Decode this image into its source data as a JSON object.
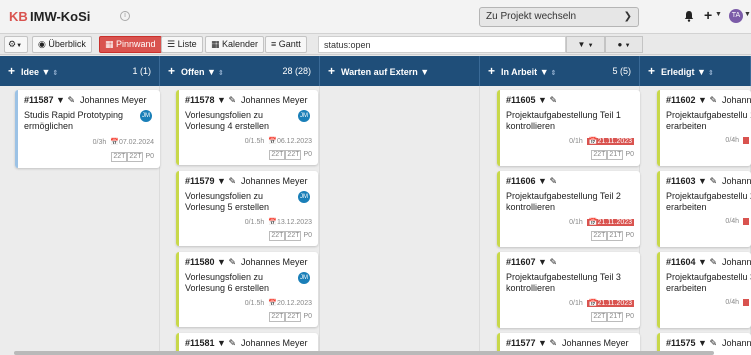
{
  "app": {
    "logo_kb": "KB",
    "name": "IMW-KoSi",
    "project_select": "Zu Projekt wechseln",
    "user_initials": "TA"
  },
  "toolbar": {
    "overview": "Überblick",
    "board": "Pinnwand",
    "list": "Liste",
    "calendar": "Kalender",
    "gantt": "Gantt",
    "search_value": "status:open"
  },
  "columns": [
    {
      "title": "Idee",
      "count": "1 (1)"
    },
    {
      "title": "Offen",
      "count": "28 (28)"
    },
    {
      "title": "Warten auf Extern",
      "count": ""
    },
    {
      "title": "In Arbeit",
      "count": "5 (5)"
    },
    {
      "title": "Erledigt",
      "count": ""
    }
  ],
  "cards": [
    {
      "id": "#11587",
      "assignee": "Johannes Meyer",
      "title": "Studis Rapid Prototyping ermöglichen",
      "time": "0/3h",
      "due": "07.02.2024",
      "overdue": false,
      "tags": [
        "22T",
        "22T"
      ],
      "priority": "P0",
      "avatar": "JM",
      "accent": "#9cc2e5"
    },
    {
      "id": "#11578",
      "assignee": "Johannes Meyer",
      "title": "Vorlesungsfolien zu Vorlesung 4 erstellen",
      "time": "0/1.5h",
      "due": "06.12.2023",
      "overdue": false,
      "tags": [
        "22T",
        "22T"
      ],
      "priority": "P0",
      "avatar": "JM",
      "accent": "#c8d84a"
    },
    {
      "id": "#11579",
      "assignee": "Johannes Meyer",
      "title": "Vorlesungsfolien zu Vorlesung 5 erstellen",
      "time": "0/1.5h",
      "due": "13.12.2023",
      "overdue": false,
      "tags": [
        "22T",
        "22T"
      ],
      "priority": "P0",
      "avatar": "JM",
      "accent": "#c8d84a"
    },
    {
      "id": "#11580",
      "assignee": "Johannes Meyer",
      "title": "Vorlesungsfolien zu Vorlesung 6 erstellen",
      "time": "0/1.5h",
      "due": "20.12.2023",
      "overdue": false,
      "tags": [
        "22T",
        "22T"
      ],
      "priority": "P0",
      "avatar": "JM",
      "accent": "#c8d84a"
    },
    {
      "id": "#11581",
      "assignee": "Johannes Meyer",
      "title": "",
      "time": "",
      "due": "",
      "overdue": false,
      "tags": [],
      "priority": "",
      "avatar": "",
      "accent": "#c8d84a"
    },
    {
      "id": "#11605",
      "assignee": "",
      "title": "Projektaufgabestellung Teil 1 kontrollieren",
      "time": "0/1h",
      "due": "21.11.2023",
      "overdue": true,
      "tags": [
        "22T",
        "21T"
      ],
      "priority": "P0",
      "avatar": "",
      "accent": "#c8d84a"
    },
    {
      "id": "#11606",
      "assignee": "",
      "title": "Projektaufgabestellung Teil 2 kontrollieren",
      "time": "0/1h",
      "due": "21.11.2023",
      "overdue": true,
      "tags": [
        "22T",
        "21T"
      ],
      "priority": "P0",
      "avatar": "",
      "accent": "#c8d84a"
    },
    {
      "id": "#11607",
      "assignee": "",
      "title": "Projektaufgabestellung Teil 3 kontrollieren",
      "time": "0/1h",
      "due": "21.11.2023",
      "overdue": true,
      "tags": [
        "22T",
        "21T"
      ],
      "priority": "P0",
      "avatar": "",
      "accent": "#c8d84a"
    },
    {
      "id": "#11577",
      "assignee": "Johannes Meyer",
      "title": "",
      "time": "",
      "due": "",
      "overdue": false,
      "tags": [],
      "priority": "",
      "avatar": "",
      "accent": "#c8d84a"
    },
    {
      "id": "#11602",
      "assignee": "Johanne",
      "title": "Projektaufgabestellu 1 erarbeiten",
      "time": "0/4h",
      "due": "",
      "overdue": true,
      "tags": [],
      "priority": "",
      "avatar": "",
      "accent": "#c8d84a"
    },
    {
      "id": "#11603",
      "assignee": "Johanne",
      "title": "Projektaufgabestellu 2 erarbeiten",
      "time": "0/4h",
      "due": "",
      "overdue": true,
      "tags": [],
      "priority": "",
      "avatar": "",
      "accent": "#c8d84a"
    },
    {
      "id": "#11604",
      "assignee": "Johanne",
      "title": "Projektaufgabestellu 3 erarbeiten",
      "time": "0/4h",
      "due": "",
      "overdue": true,
      "tags": [],
      "priority": "",
      "avatar": "",
      "accent": "#c8d84a"
    },
    {
      "id": "#11575",
      "assignee": "Johanne",
      "title": "",
      "time": "",
      "due": "",
      "overdue": false,
      "tags": [],
      "priority": "",
      "avatar": "",
      "accent": "#c8d84a"
    }
  ]
}
